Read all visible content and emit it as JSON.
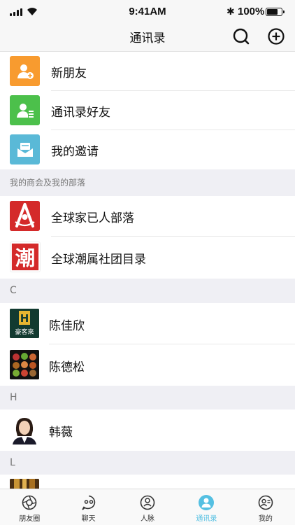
{
  "status_bar": {
    "time": "9:41AM",
    "battery": "100%",
    "battery_level": 0.78
  },
  "nav": {
    "title": "通讯录"
  },
  "top_items": [
    {
      "label": "新朋友",
      "color": "#f89b2f"
    },
    {
      "label": "通讯录好友",
      "color": "#4cc04b"
    },
    {
      "label": "我的邀请",
      "color": "#5ab9d7"
    }
  ],
  "sections": {
    "groups": "我的商会及我的部落",
    "c": "C",
    "h": "H",
    "l": "L"
  },
  "groups": [
    {
      "label": "全球家已人部落",
      "glyph": "人",
      "color": "#d42a2a"
    },
    {
      "label": "全球潮属社团目录",
      "glyph": "潮",
      "color": "#d42a2a"
    }
  ],
  "contacts": [
    {
      "label": "陈佳欣",
      "avatar_text": "豪客來"
    },
    {
      "label": "陈德松"
    },
    {
      "label": "韩薇"
    }
  ],
  "tabs": [
    {
      "label": "朋友圈",
      "icon": "camera-lens-icon"
    },
    {
      "label": "聊天",
      "icon": "chat-face-icon"
    },
    {
      "label": "人脉",
      "icon": "network-face-icon"
    },
    {
      "label": "通讯录",
      "icon": "contact-person-icon",
      "active": true
    },
    {
      "label": "我的",
      "icon": "profile-card-icon"
    }
  ],
  "colors": {
    "accent": "#55c0e2",
    "section_bg": "#efeff4"
  }
}
